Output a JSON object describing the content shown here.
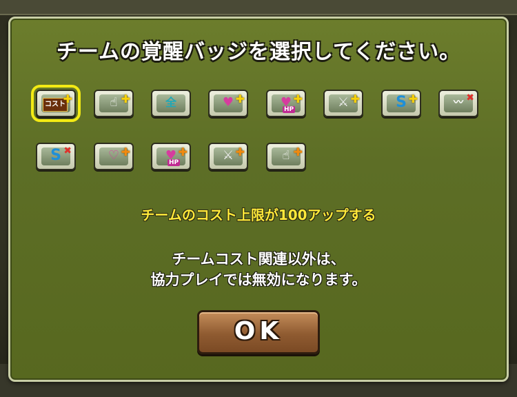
{
  "dialog": {
    "title": "チームの覚醒バッジを選択してください。",
    "description": "チームのコスト上限が100アップする",
    "note_line1": "チームコスト関連以外は、",
    "note_line2": "協力プレイでは無効になります。",
    "ok_label": "OK"
  },
  "badges": [
    {
      "name": "cost-up-badge",
      "icon": "cost-icon",
      "label": "コスト",
      "selected": true
    },
    {
      "name": "hand-plus-badge",
      "icon": "hand-icon",
      "selected": false
    },
    {
      "name": "all-stat-badge",
      "icon": "all-icon",
      "label": "全",
      "selected": false
    },
    {
      "name": "heart-plus-badge",
      "icon": "heart-icon",
      "selected": false
    },
    {
      "name": "hp-plus-badge",
      "icon": "hp-icon",
      "label": "HP",
      "selected": false
    },
    {
      "name": "attack-plus-badge",
      "icon": "sword-icon",
      "selected": false
    },
    {
      "name": "skill-boost-badge",
      "icon": "skill-icon",
      "selected": false
    },
    {
      "name": "resist-badge",
      "icon": "resist-icon",
      "selected": false
    },
    {
      "name": "skill-bind-resist-badge",
      "icon": "skill-cross-icon",
      "selected": false
    },
    {
      "name": "heart-plus-large-badge",
      "icon": "heart-icon",
      "selected": false
    },
    {
      "name": "hp-plus-large-badge",
      "icon": "hp-icon",
      "label": "HP",
      "selected": false
    },
    {
      "name": "attack-plus-large-badge",
      "icon": "sword-icon",
      "selected": false
    },
    {
      "name": "hand-plus-large-badge",
      "icon": "hand-icon",
      "selected": false
    }
  ],
  "colors": {
    "panel": "#5d6e26",
    "highlight": "#f3ea14",
    "description": "#ffe93a",
    "ok_button": "#8f5b31"
  }
}
